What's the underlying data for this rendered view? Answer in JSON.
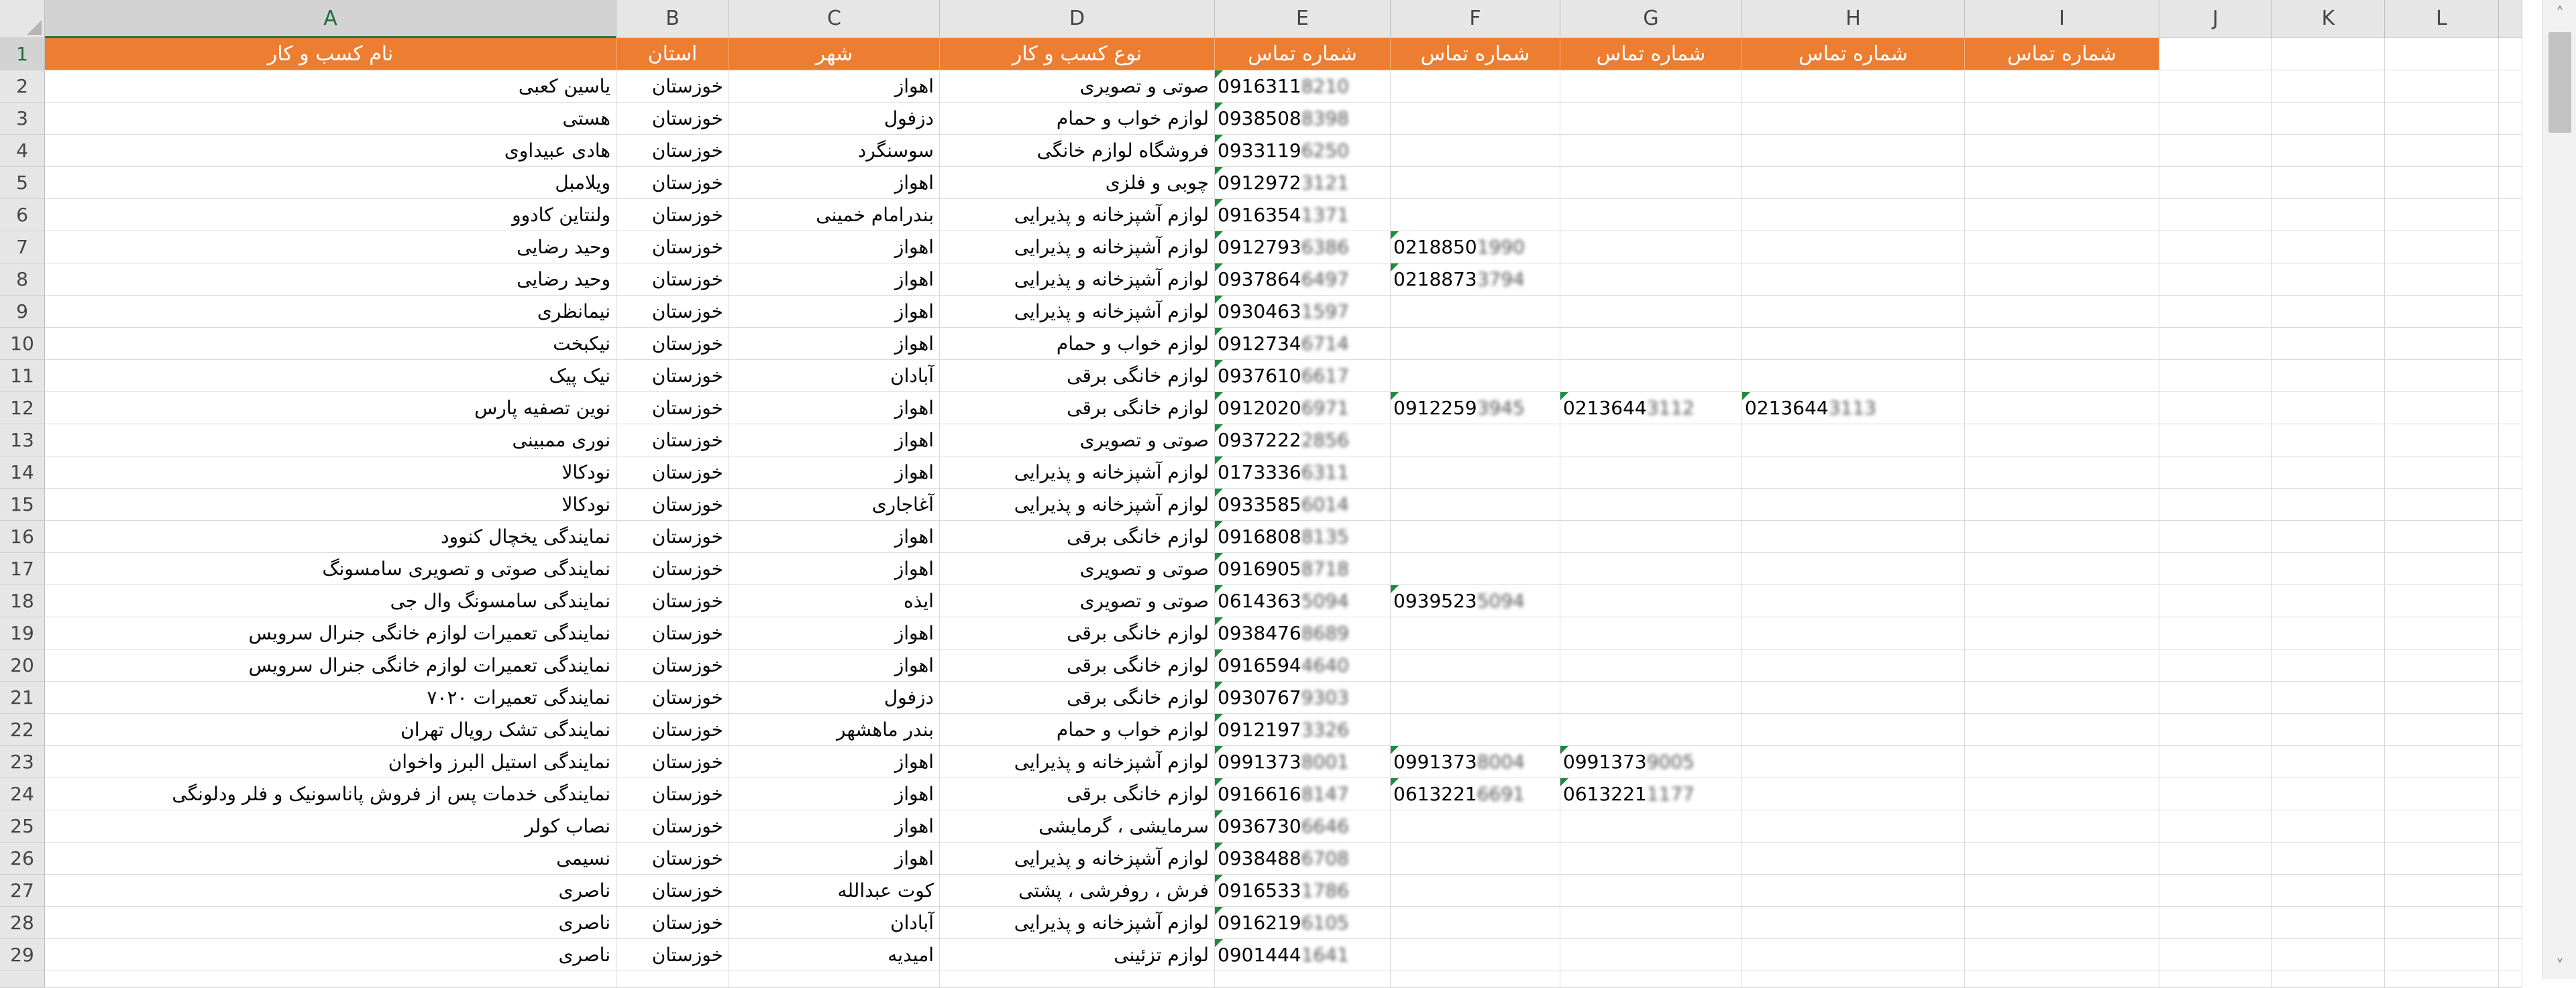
{
  "columns": [
    "A",
    "B",
    "C",
    "D",
    "E",
    "F",
    "G",
    "H",
    "I",
    "J",
    "K",
    "L"
  ],
  "selected_column": "A",
  "selected_row": 1,
  "header_row": [
    "نام کسب و کار",
    "استان",
    "شهر",
    "نوع کسب و کار",
    "شماره تماس",
    "شماره تماس",
    "شماره تماس",
    "شماره تماس",
    "شماره تماس"
  ],
  "header_color": "#ed7d31",
  "rows": [
    {
      "n": "2",
      "a": "یاسین کعبی",
      "b": "خوزستان",
      "c": "اهواز",
      "d": "صوتی و تصویری",
      "e": "0916311",
      "e2": "8210",
      "f": "",
      "f2": "",
      "g": "",
      "g2": "",
      "h": "",
      "h2": ""
    },
    {
      "n": "3",
      "a": "هستی",
      "b": "خوزستان",
      "c": "دزفول",
      "d": "لوازم خواب و حمام",
      "e": "0938508",
      "e2": "8398",
      "f": "",
      "f2": "",
      "g": "",
      "g2": "",
      "h": "",
      "h2": ""
    },
    {
      "n": "4",
      "a": "هادی عبیداوی",
      "b": "خوزستان",
      "c": "سوسنگرد",
      "d": "فروشگاه لوازم خانگی",
      "e": "0933119",
      "e2": "6250",
      "f": "",
      "f2": "",
      "g": "",
      "g2": "",
      "h": "",
      "h2": ""
    },
    {
      "n": "5",
      "a": "ویلامبل",
      "b": "خوزستان",
      "c": "اهواز",
      "d": "چوبی و فلزی",
      "e": "0912972",
      "e2": "3121",
      "f": "",
      "f2": "",
      "g": "",
      "g2": "",
      "h": "",
      "h2": ""
    },
    {
      "n": "6",
      "a": "ولنتاین کادوو",
      "b": "خوزستان",
      "c": "بندرامام خمینی",
      "d": "لوازم آشپزخانه و پذیرایی",
      "e": "0916354",
      "e2": "1371",
      "f": "",
      "f2": "",
      "g": "",
      "g2": "",
      "h": "",
      "h2": ""
    },
    {
      "n": "7",
      "a": "وحید رضایی",
      "b": "خوزستان",
      "c": "اهواز",
      "d": "لوازم آشپزخانه و پذیرایی",
      "e": "0912793",
      "e2": "6386",
      "f": "0218850",
      "f2": "1990",
      "g": "",
      "g2": "",
      "h": "",
      "h2": ""
    },
    {
      "n": "8",
      "a": "وحید رضایی",
      "b": "خوزستان",
      "c": "اهواز",
      "d": "لوازم آشپزخانه و پذیرایی",
      "e": "0937864",
      "e2": "6497",
      "f": "0218873",
      "f2": "3794",
      "g": "",
      "g2": "",
      "h": "",
      "h2": ""
    },
    {
      "n": "9",
      "a": "نیمانظری",
      "b": "خوزستان",
      "c": "اهواز",
      "d": "لوازم آشپزخانه و پذیرایی",
      "e": "0930463",
      "e2": "1597",
      "f": "",
      "f2": "",
      "g": "",
      "g2": "",
      "h": "",
      "h2": ""
    },
    {
      "n": "10",
      "a": "نیکبخت",
      "b": "خوزستان",
      "c": "اهواز",
      "d": "لوازم خواب و حمام",
      "e": "0912734",
      "e2": "6714",
      "f": "",
      "f2": "",
      "g": "",
      "g2": "",
      "h": "",
      "h2": ""
    },
    {
      "n": "11",
      "a": "نیک پیک",
      "b": "خوزستان",
      "c": "آبادان",
      "d": "لوازم خانگی برقی",
      "e": "0937610",
      "e2": "6617",
      "f": "",
      "f2": "",
      "g": "",
      "g2": "",
      "h": "",
      "h2": ""
    },
    {
      "n": "12",
      "a": "نوین تصفیه پارس",
      "b": "خوزستان",
      "c": "اهواز",
      "d": "لوازم خانگی برقی",
      "e": "0912020",
      "e2": "6971",
      "f": "0912259",
      "f2": "3945",
      "g": "0213644",
      "g2": "3112",
      "h": "0213644",
      "h2": "3113"
    },
    {
      "n": "13",
      "a": "نوری ممبینی",
      "b": "خوزستان",
      "c": "اهواز",
      "d": "صوتی و تصویری",
      "e": "0937222",
      "e2": "2856",
      "f": "",
      "f2": "",
      "g": "",
      "g2": "",
      "h": "",
      "h2": ""
    },
    {
      "n": "14",
      "a": "نودکالا",
      "b": "خوزستان",
      "c": "اهواز",
      "d": "لوازم آشپزخانه و پذیرایی",
      "e": "0173336",
      "e2": "6311",
      "f": "",
      "f2": "",
      "g": "",
      "g2": "",
      "h": "",
      "h2": ""
    },
    {
      "n": "15",
      "a": "نودکالا",
      "b": "خوزستان",
      "c": "آغاجاری",
      "d": "لوازم آشپزخانه و پذیرایی",
      "e": "0933585",
      "e2": "6014",
      "f": "",
      "f2": "",
      "g": "",
      "g2": "",
      "h": "",
      "h2": ""
    },
    {
      "n": "16",
      "a": "نمایندگی یخچال کنوود",
      "b": "خوزستان",
      "c": "اهواز",
      "d": "لوازم خانگی برقی",
      "e": "0916808",
      "e2": "8135",
      "f": "",
      "f2": "",
      "g": "",
      "g2": "",
      "h": "",
      "h2": ""
    },
    {
      "n": "17",
      "a": "نمایندگی صوتی و تصویری سامسونگ",
      "b": "خوزستان",
      "c": "اهواز",
      "d": "صوتی و تصویری",
      "e": "0916905",
      "e2": "8718",
      "f": "",
      "f2": "",
      "g": "",
      "g2": "",
      "h": "",
      "h2": ""
    },
    {
      "n": "18",
      "a": "نمایندگی سامسونگ وال جی",
      "b": "خوزستان",
      "c": "ایذه",
      "d": "صوتی و تصویری",
      "e": "0614363",
      "e2": "5094",
      "f": "0939523",
      "f2": "5094",
      "g": "",
      "g2": "",
      "h": "",
      "h2": ""
    },
    {
      "n": "19",
      "a": "نمایندگی تعمیرات لوازم خانگی جنرال سرویس",
      "b": "خوزستان",
      "c": "اهواز",
      "d": "لوازم خانگی برقی",
      "e": "0938476",
      "e2": "8689",
      "f": "",
      "f2": "",
      "g": "",
      "g2": "",
      "h": "",
      "h2": ""
    },
    {
      "n": "20",
      "a": "نمایندگی تعمیرات لوازم خانگی جنرال سرویس",
      "b": "خوزستان",
      "c": "اهواز",
      "d": "لوازم خانگی برقی",
      "e": "0916594",
      "e2": "4640",
      "f": "",
      "f2": "",
      "g": "",
      "g2": "",
      "h": "",
      "h2": ""
    },
    {
      "n": "21",
      "a": "نمایندگی تعمیرات ۷۰۲۰",
      "b": "خوزستان",
      "c": "دزفول",
      "d": "لوازم خانگی برقی",
      "e": "0930767",
      "e2": "9303",
      "f": "",
      "f2": "",
      "g": "",
      "g2": "",
      "h": "",
      "h2": ""
    },
    {
      "n": "22",
      "a": "نمایندگی تشک رویال تهران",
      "b": "خوزستان",
      "c": "بندر ماهشهر",
      "d": "لوازم خواب و حمام",
      "e": "0912197",
      "e2": "3326",
      "f": "",
      "f2": "",
      "g": "",
      "g2": "",
      "h": "",
      "h2": ""
    },
    {
      "n": "23",
      "a": "نمایندگی استیل البرز واخوان",
      "b": "خوزستان",
      "c": "اهواز",
      "d": "لوازم آشپزخانه و پذیرایی",
      "e": "0991373",
      "e2": "8001",
      "f": "0991373",
      "f2": "8004",
      "g": "0991373",
      "g2": "9005",
      "h": "",
      "h2": ""
    },
    {
      "n": "24",
      "a": "نمایندگی خدمات پس از فروش پاناسونیک و فلر ودلونگی",
      "b": "خوزستان",
      "c": "اهواز",
      "d": "لوازم خانگی برقی",
      "e": "0916616",
      "e2": "8147",
      "f": "0613221",
      "f2": "6691",
      "g": "0613221",
      "g2": "1177",
      "h": "",
      "h2": ""
    },
    {
      "n": "25",
      "a": "نصاب کولر",
      "b": "خوزستان",
      "c": "اهواز",
      "d": "سرمایشی ، گرمایشی",
      "e": "0936730",
      "e2": "6646",
      "f": "",
      "f2": "",
      "g": "",
      "g2": "",
      "h": "",
      "h2": ""
    },
    {
      "n": "26",
      "a": "نسیمی",
      "b": "خوزستان",
      "c": "اهواز",
      "d": "لوازم آشپزخانه و پذیرایی",
      "e": "0938488",
      "e2": "6708",
      "f": "",
      "f2": "",
      "g": "",
      "g2": "",
      "h": "",
      "h2": ""
    },
    {
      "n": "27",
      "a": "ناصری",
      "b": "خوزستان",
      "c": "کوت عبدالله",
      "d": "فرش ، روفرشی ، پشتی",
      "e": "0916533",
      "e2": "1786",
      "f": "",
      "f2": "",
      "g": "",
      "g2": "",
      "h": "",
      "h2": ""
    },
    {
      "n": "28",
      "a": "ناصری",
      "b": "خوزستان",
      "c": "آبادان",
      "d": "لوازم آشپزخانه و پذیرایی",
      "e": "0916219",
      "e2": "6105",
      "f": "",
      "f2": "",
      "g": "",
      "g2": "",
      "h": "",
      "h2": ""
    },
    {
      "n": "29",
      "a": "ناصری",
      "b": "خوزستان",
      "c": "امیدیه",
      "d": "لوازم تزئینی",
      "e": "0901444",
      "e2": "1641",
      "f": "",
      "f2": "",
      "g": "",
      "g2": "",
      "h": "",
      "h2": ""
    }
  ]
}
